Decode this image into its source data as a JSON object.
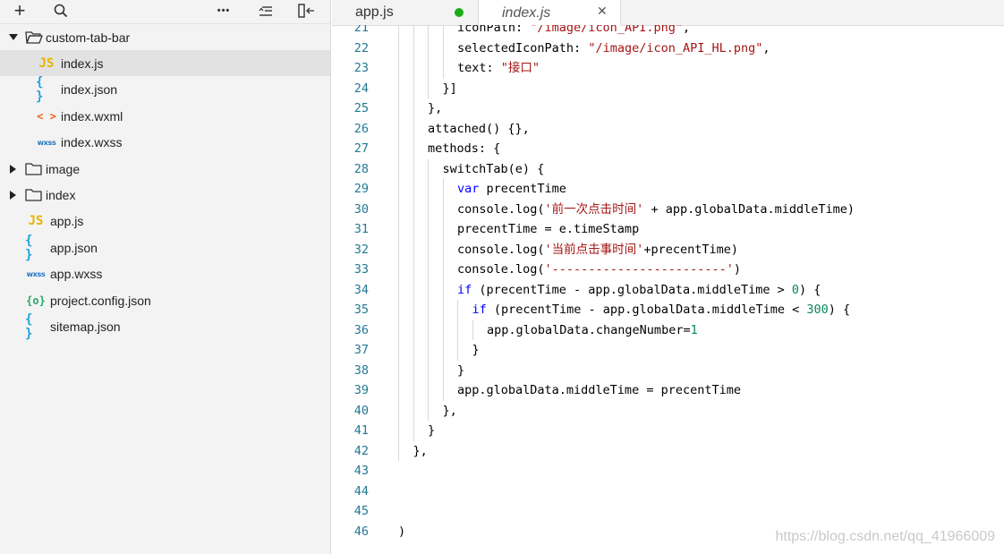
{
  "sidebar": {
    "toolbar": {
      "add_icon": "+",
      "search_icon": "search",
      "more_icon": "•••",
      "collapse_icon": "collapse-all",
      "split_icon": "split-left"
    },
    "tree": [
      {
        "label": "custom-tab-bar",
        "kind": "folder-open",
        "depth": 0,
        "expanded": true
      },
      {
        "label": "index.js",
        "kind": "js",
        "depth": 1,
        "selected": true
      },
      {
        "label": "index.json",
        "kind": "json",
        "depth": 1
      },
      {
        "label": "index.wxml",
        "kind": "wxml",
        "depth": 1
      },
      {
        "label": "index.wxss",
        "kind": "wxss",
        "depth": 1
      },
      {
        "label": "image",
        "kind": "folder",
        "depth": 0,
        "expanded": false
      },
      {
        "label": "index",
        "kind": "folder",
        "depth": 0,
        "expanded": false
      },
      {
        "label": "app.js",
        "kind": "js",
        "depth": 0
      },
      {
        "label": "app.json",
        "kind": "json",
        "depth": 0
      },
      {
        "label": "app.wxss",
        "kind": "wxss",
        "depth": 0
      },
      {
        "label": "project.config.json",
        "kind": "config",
        "depth": 0
      },
      {
        "label": "sitemap.json",
        "kind": "json",
        "depth": 0
      }
    ],
    "icon_glyphs": {
      "js": "JS",
      "json": "{ }",
      "wxml": "< >",
      "wxss": "wxss",
      "config": "{o}"
    }
  },
  "tabs": [
    {
      "label": "app.js",
      "modified": true,
      "active": false
    },
    {
      "label": "index.js",
      "modified": false,
      "active": true,
      "close": "✕"
    }
  ],
  "editor": {
    "lines": [
      {
        "n": "21",
        "indent": 4,
        "tokens": [
          [
            "pl",
            "iconPath: "
          ],
          [
            "str",
            "\"/image/icon_API.png\""
          ],
          [
            "pl",
            ","
          ]
        ]
      },
      {
        "n": "22",
        "indent": 4,
        "tokens": [
          [
            "pl",
            "selectedIconPath: "
          ],
          [
            "str",
            "\"/image/icon_API_HL.png\""
          ],
          [
            "pl",
            ","
          ]
        ]
      },
      {
        "n": "23",
        "indent": 4,
        "tokens": [
          [
            "pl",
            "text: "
          ],
          [
            "str",
            "\"接口\""
          ]
        ]
      },
      {
        "n": "24",
        "indent": 3,
        "tokens": [
          [
            "pl",
            "}]"
          ]
        ]
      },
      {
        "n": "25",
        "indent": 2,
        "tokens": [
          [
            "pl",
            "},"
          ]
        ]
      },
      {
        "n": "26",
        "indent": 2,
        "tokens": [
          [
            "pl",
            "attached() {},"
          ]
        ]
      },
      {
        "n": "27",
        "indent": 2,
        "tokens": [
          [
            "pl",
            "methods: {"
          ]
        ]
      },
      {
        "n": "28",
        "indent": 3,
        "tokens": [
          [
            "pl",
            "switchTab(e) {"
          ]
        ]
      },
      {
        "n": "29",
        "indent": 4,
        "tokens": [
          [
            "kw",
            "var"
          ],
          [
            "pl",
            " precentTime"
          ]
        ]
      },
      {
        "n": "30",
        "indent": 4,
        "tokens": [
          [
            "pl",
            "console.log("
          ],
          [
            "str",
            "'前一次点击时间'"
          ],
          [
            "pl",
            " + app.globalData.middleTime)"
          ]
        ]
      },
      {
        "n": "31",
        "indent": 4,
        "tokens": [
          [
            "pl",
            "precentTime = e.timeStamp"
          ]
        ]
      },
      {
        "n": "32",
        "indent": 4,
        "tokens": [
          [
            "pl",
            "console.log("
          ],
          [
            "str",
            "'当前点击事时间'"
          ],
          [
            "pl",
            "+precentTime)"
          ]
        ]
      },
      {
        "n": "33",
        "indent": 4,
        "tokens": [
          [
            "pl",
            "console.log("
          ],
          [
            "str",
            "'------------------------'"
          ],
          [
            "pl",
            ")"
          ]
        ]
      },
      {
        "n": "34",
        "indent": 4,
        "tokens": [
          [
            "kw",
            "if"
          ],
          [
            "pl",
            " (precentTime - app.globalData.middleTime > "
          ],
          [
            "num",
            "0"
          ],
          [
            "pl",
            ") {"
          ]
        ]
      },
      {
        "n": "35",
        "indent": 5,
        "tokens": [
          [
            "kw",
            "if"
          ],
          [
            "pl",
            " (precentTime - app.globalData.middleTime < "
          ],
          [
            "num",
            "300"
          ],
          [
            "pl",
            ") {"
          ]
        ]
      },
      {
        "n": "36",
        "indent": 6,
        "tokens": [
          [
            "pl",
            "app.globalData.changeNumber="
          ],
          [
            "num",
            "1"
          ]
        ]
      },
      {
        "n": "37",
        "indent": 5,
        "tokens": [
          [
            "pl",
            "}"
          ]
        ]
      },
      {
        "n": "38",
        "indent": 4,
        "tokens": [
          [
            "pl",
            "}"
          ]
        ]
      },
      {
        "n": "39",
        "indent": 4,
        "tokens": [
          [
            "pl",
            "app.globalData.middleTime = precentTime"
          ]
        ]
      },
      {
        "n": "40",
        "indent": 3,
        "tokens": [
          [
            "pl",
            "},"
          ]
        ]
      },
      {
        "n": "41",
        "indent": 2,
        "tokens": [
          [
            "pl",
            "}"
          ]
        ]
      },
      {
        "n": "42",
        "indent": 1,
        "tokens": [
          [
            "pl",
            "},"
          ]
        ]
      },
      {
        "n": "43",
        "indent": 0,
        "tokens": []
      },
      {
        "n": "44",
        "indent": 0,
        "tokens": []
      },
      {
        "n": "45",
        "indent": 0,
        "tokens": []
      },
      {
        "n": "46",
        "indent": 0,
        "tokens": [
          [
            "pl",
            ")"
          ]
        ]
      }
    ]
  },
  "watermark": "https://blog.csdn.net/qq_41966009",
  "colors": {
    "modified_dot": "#1aad19",
    "string": "#a31515",
    "keyword": "#0000ff",
    "number": "#098658",
    "line_number": "#237893"
  }
}
